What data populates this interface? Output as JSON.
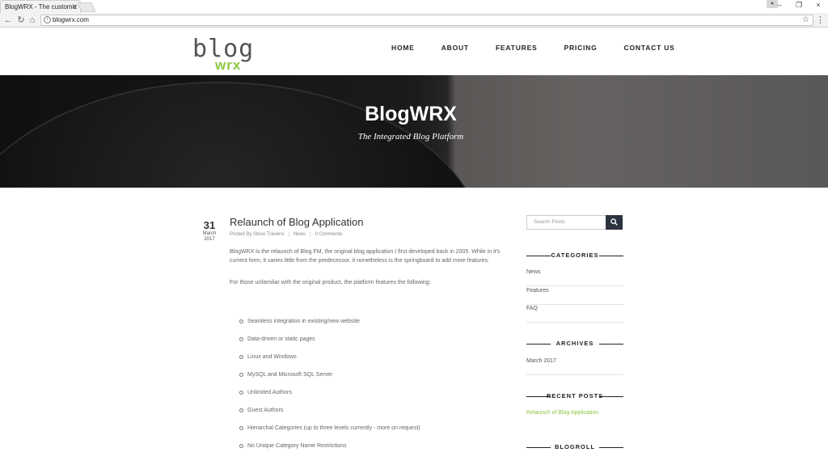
{
  "browser": {
    "tab_title": "BlogWRX - The customiz",
    "tab_close": "×",
    "url": "blogwrx.com",
    "info_glyph": "i",
    "star_glyph": "☆",
    "menu_glyph": "⋮",
    "back_glyph": "←",
    "forward_glyph": "→",
    "reload_glyph": "↻",
    "home_glyph": "⌂",
    "minimize_glyph": "–",
    "restore_glyph": "❐",
    "close_glyph": "×"
  },
  "site": {
    "logo_top": "blog",
    "logo_bottom": "wrx",
    "nav": [
      "HOME",
      "ABOUT",
      "FEATURES",
      "PRICING",
      "CONTACT US"
    ],
    "brand_color": "#8dc63f"
  },
  "hero": {
    "title": "BlogWRX",
    "subtitle": "The Integrated Blog Platform"
  },
  "post": {
    "day": "31",
    "month": "March",
    "year": "2017",
    "title": "Relaunch of Blog Application",
    "author": "Posted By Steve Traversi",
    "category": "News",
    "comments": "0 Comments",
    "para1": "BlogWRX is the relaunch of Blog FM, the original blog application I first developed back in 2005. While in it's current form, it varies little from the predecessor, it nonetheless is the springboard to add more features.",
    "para2": "For those unfamiliar with the original product, the platform features the following:",
    "features": [
      "Seamless integration in existing/new website",
      "Data-driven or static pages",
      "Linux and Windows",
      "MySQL and Microsoft SQL Server",
      "Unlimited Authors",
      "Guest Authors",
      "Hierarchal Categories (up to three levels currently - more on request)",
      "No Unique Category Name Restrictions"
    ]
  },
  "sidebar": {
    "search_placeholder": "Search Posts",
    "categories_title": "CATEGORIES",
    "categories": [
      "News",
      "Features",
      "FAQ"
    ],
    "archives_title": "ARCHIVES",
    "archives": [
      "March 2017"
    ],
    "recent_title": "RECENT POSTS",
    "recent": [
      "Relaunch of Blog Application"
    ],
    "blogroll_title": "BLOGROLL"
  }
}
